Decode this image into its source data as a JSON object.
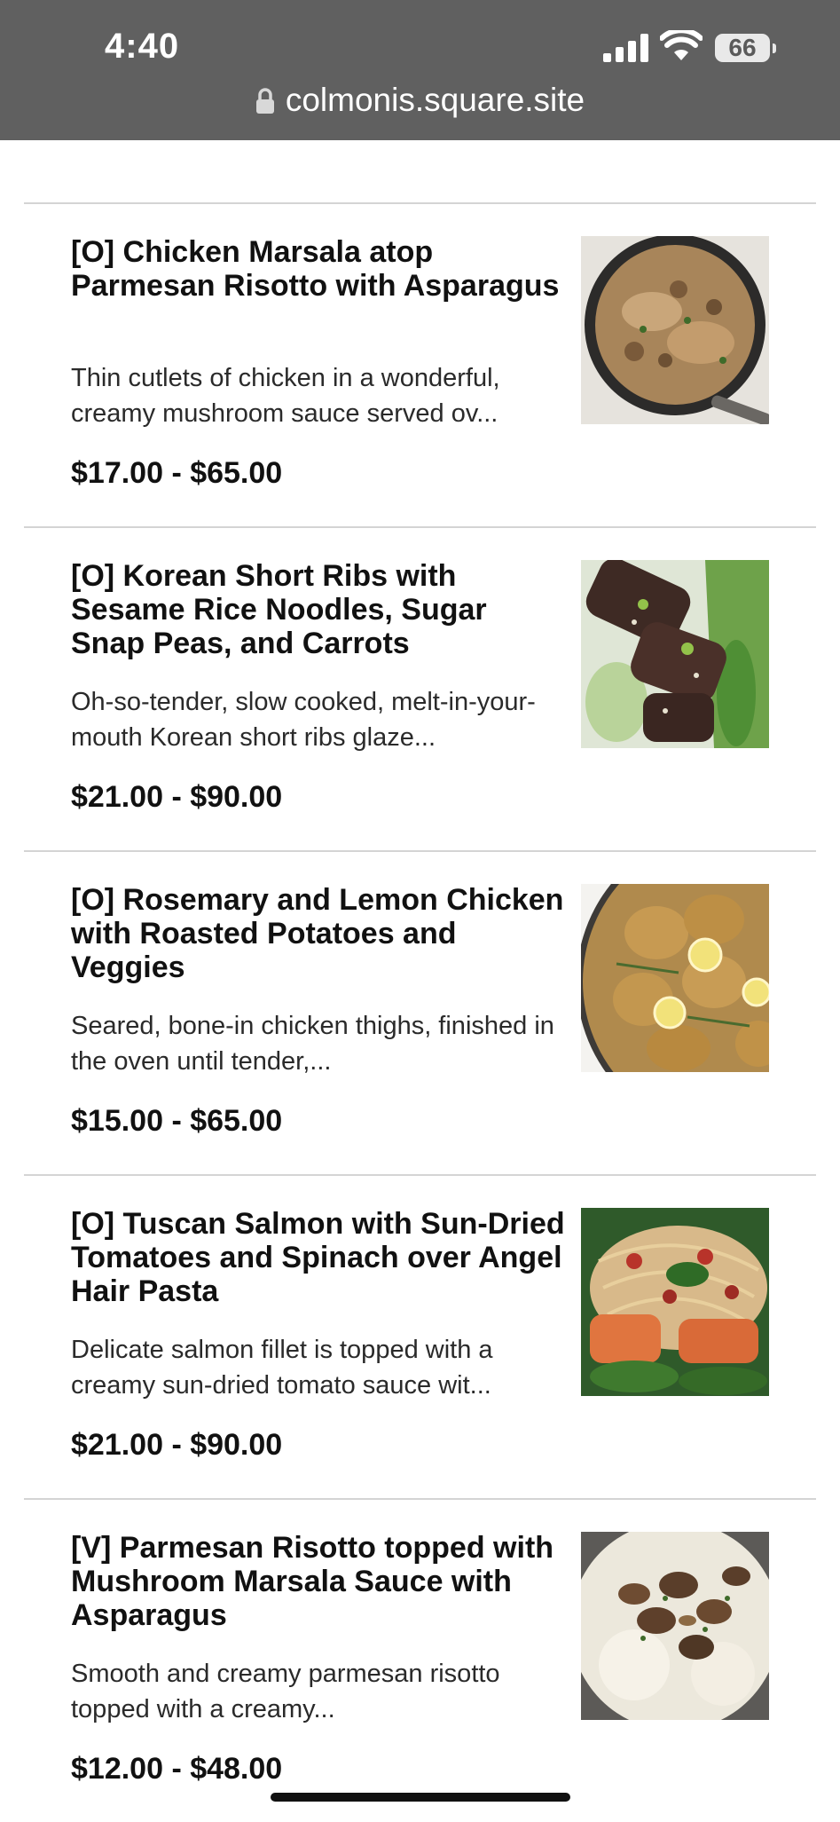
{
  "status_bar": {
    "time": "4:40",
    "battery": "66",
    "url": "colmonis.square.site"
  },
  "menu_items": [
    {
      "title": "[O] Chicken Marsala atop Parmesan Risotto with Asparagus",
      "description": "Thin cutlets of chicken in a wonderful, creamy mushroom sauce served ov...",
      "price": "$17.00 - $65.00"
    },
    {
      "title": "[O] Korean Short Ribs with Sesame Rice Noodles, Sugar Snap Peas, and Carrots",
      "description": "Oh-so-tender, slow cooked, melt-in-your-mouth Korean short ribs glaze...",
      "price": "$21.00 - $90.00"
    },
    {
      "title": "[O] Rosemary and Lemon Chicken with Roasted Potatoes and Veggies",
      "description": "Seared, bone-in chicken thighs, finished in the oven until tender,...",
      "price": "$15.00 - $65.00"
    },
    {
      "title": "[O] Tuscan Salmon with Sun-Dried Tomatoes and Spinach over Angel Hair Pasta",
      "description": "Delicate salmon fillet is topped with a creamy sun-dried tomato sauce wit...",
      "price": "$21.00 - $90.00"
    },
    {
      "title": "[V] Parmesan Risotto topped with Mushroom Marsala Sauce with Asparagus",
      "description": "Smooth and creamy parmesan risotto topped with a creamy...",
      "price": "$12.00 - $48.00"
    }
  ]
}
